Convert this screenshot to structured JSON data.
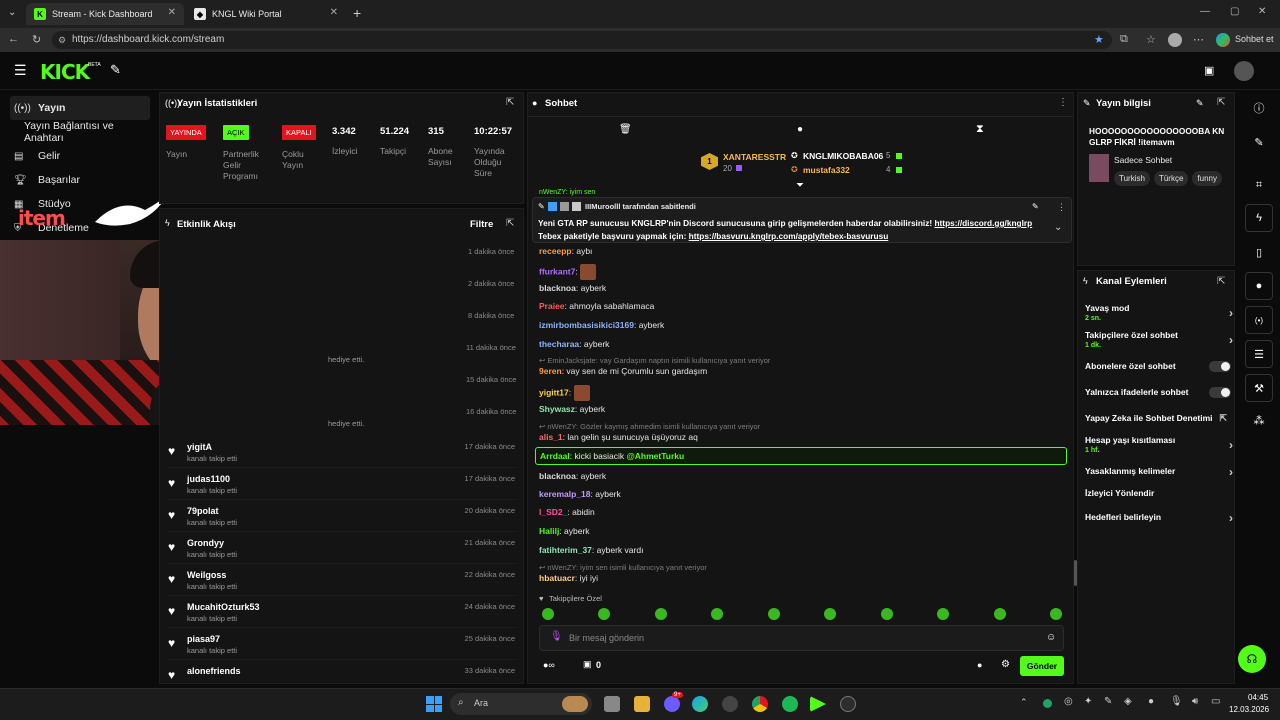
{
  "browser": {
    "tabs": [
      {
        "title": "Stream - Kick Dashboard",
        "active": true
      },
      {
        "title": "KNGL Wiki Portal",
        "active": false
      }
    ],
    "url": "https://dashboard.kick.com/stream",
    "profile_label": "Sohbet et"
  },
  "header": {
    "logo": "KICK",
    "beta": "BETA"
  },
  "sidebar": {
    "items": [
      {
        "label": "Yayın",
        "icon": "broadcast-icon"
      },
      {
        "label": "Yayın Bağlantısı ve Anahtarı",
        "icon": "key-icon"
      },
      {
        "label": "Gelir",
        "icon": "money-icon"
      },
      {
        "label": "Başarılar",
        "icon": "trophy-icon"
      },
      {
        "label": "Stüdyo",
        "icon": "studio-icon"
      },
      {
        "label": "Denetleme",
        "icon": "shield-icon"
      }
    ]
  },
  "stats_panel": {
    "title": "Yayın İstatistikleri",
    "badges": [
      {
        "badge": "YAYINDA",
        "label": "Yayın",
        "color": "#e4141e"
      },
      {
        "badge": "AÇIK",
        "label": "Partnerlik Gelir Programı",
        "color": "#53fc18"
      },
      {
        "badge": "KAPALI",
        "label": "Çoklu Yayın",
        "color": "#e4141e"
      }
    ],
    "numbers": [
      {
        "value": "3.342",
        "label": "İzleyici"
      },
      {
        "value": "51.224",
        "label": "Takipçi"
      },
      {
        "value": "315",
        "label": "Abone Sayısı"
      },
      {
        "value": "10:22:57",
        "label": "Yayında Olduğu Süre"
      }
    ]
  },
  "activity": {
    "title": "Etkinlik Akışı",
    "filter": "Filtre",
    "hidden_times": [
      "1 dakika önce",
      "2 dakika önce",
      "8 dakika önce",
      "11 dakika önce",
      "15 dakika önce",
      "16 dakika önce"
    ],
    "partial_texts": [
      "hediye etti.",
      "kanalı takip etti.",
      "hediye etti."
    ],
    "rows": [
      {
        "name": "yigitA",
        "sub": "kanalı takip etti",
        "time": "17 dakika önce"
      },
      {
        "name": "judas1100",
        "sub": "kanalı takip etti",
        "time": "17 dakika önce"
      },
      {
        "name": "79polat",
        "sub": "kanalı takip etti",
        "time": "20 dakika önce"
      },
      {
        "name": "Grondyy",
        "sub": "kanalı takip etti",
        "time": "21 dakika önce"
      },
      {
        "name": "Weilgoss",
        "sub": "kanalı takip etti",
        "time": "22 dakika önce"
      },
      {
        "name": "MucahitOzturk53",
        "sub": "kanalı takip etti",
        "time": "24 dakika önce"
      },
      {
        "name": "piasa97",
        "sub": "kanalı takip etti",
        "time": "25 dakika önce"
      },
      {
        "name": "alonefriends",
        "sub": "",
        "time": "33 dakika önce"
      }
    ]
  },
  "chat": {
    "title": "Sohbet",
    "leaderboard": {
      "first": {
        "rank": "1",
        "name": "XANTARESSTR",
        "points": "20"
      },
      "second": {
        "name": "KNGLMIKOBABA06",
        "points": "5"
      },
      "third": {
        "name": "mustafa332",
        "points": "4"
      }
    },
    "pinned": {
      "by": "IIIMuroolll tarafından sabitlendi",
      "text1": "Yeni GTA RP sunucusu KNGLRP'nin Discord sunucusuna girip gelişmelerden haberdar olabilirsiniz!",
      "link1": "https://discord.gg/knglrp",
      "text2": "Tebex paketiyle başvuru yapmak için:",
      "link2": "https://basvuru.knglrp.com/apply/tebex-basvurusu",
      "partial_msg": "nWenZY: iyim sen"
    },
    "messages": [
      {
        "user": "receepp",
        "text": "aybı",
        "color": "#ff9a3c"
      },
      {
        "user": "ffurkant7",
        "text": "",
        "color": "#b06cff"
      },
      {
        "user": "blacknoa",
        "text": "ayberk",
        "color": "#d9d9d9"
      },
      {
        "user": "Praiee",
        "text": "ahmoyla sabahlamaca",
        "color": "#ff5a5a"
      },
      {
        "user": "izmirbombasisikici3169",
        "text": "ayberk",
        "color": "#8ab4ff"
      },
      {
        "user": "thecharaa",
        "text": "ayberk",
        "color": "#8ab4ff"
      },
      {
        "reply": "EminJacksjate: vay Gardaşım naptın isimili kullanıcıya yanıt veriyor"
      },
      {
        "user": "9eren",
        "text": "vay sen de mi Çorumlu sun gardaşım",
        "color": "#ff9a3c"
      },
      {
        "user": "yigitt17",
        "text": "",
        "color": "#ffd23c"
      },
      {
        "user": "Shywasz",
        "text": "ayberk",
        "color": "#8ee4b0"
      },
      {
        "reply": "nWenZY: Gözler kaymış ahmedim isimli kullanıcıya yanıt veriyor"
      },
      {
        "user": "alis_1",
        "text": "lan gelin şu sunucuya üşüyoruz aq",
        "color": "#ff6a6a"
      },
      {
        "user": "Arrdaal",
        "text": "kicki basiacik",
        "mention": "@AhmetTurku",
        "color": "#53fc18",
        "highlight": true
      },
      {
        "user": "blacknoa",
        "text": "ayberk",
        "color": "#d9d9d9"
      },
      {
        "user": "keremalp_18",
        "text": "ayberk",
        "color": "#c39bff"
      },
      {
        "user": "l_SD2_",
        "text": "abidin",
        "color": "#ff4fa0"
      },
      {
        "user": "Halilj",
        "text": "ayberk",
        "color": "#53fc18"
      },
      {
        "user": "fatihterim_37",
        "text": "ayberk vardı",
        "color": "#8ee4b0"
      },
      {
        "reply": "nWenZY: iyim sen isimli kullanıcıya yanıt veriyor"
      },
      {
        "user": "hbatuacr",
        "text": "iyi iyi",
        "color": "#ffd27a"
      }
    ],
    "followers_only": "Takipçilere Özel",
    "input_placeholder": "Bir mesaj gönderin",
    "send": "Gönder",
    "footer_count": "0"
  },
  "stream_info": {
    "title": "Yayın bilgisi",
    "stream_title": "HOOOOOOOOOOOOOOOOBA KNGLRP FİKRİ !itemavm",
    "category": "Sadece Sohbet",
    "tags": [
      "Turkish",
      "Türkçe",
      "funny"
    ]
  },
  "channel_actions": {
    "title": "Kanal Eylemleri",
    "rows": [
      {
        "label": "Yavaş mod",
        "sub": "2 sn.",
        "control": "chevron"
      },
      {
        "label": "Takipçilere özel sohbet",
        "sub": "1 dk.",
        "control": "chevron"
      },
      {
        "label": "Abonelere özel sohbet",
        "sub": "",
        "control": "toggle"
      },
      {
        "label": "Yalnızca ifadelerle sohbet",
        "sub": "",
        "control": "toggle"
      },
      {
        "label": "Yapay Zeka ile Sohbet Denetimi",
        "sub": "",
        "control": "external"
      },
      {
        "label": "Hesap yaşı kısıtlaması",
        "sub": "1 hf.",
        "control": "chevron"
      },
      {
        "label": "Yasaklanmış kelimeler",
        "sub": "",
        "control": "chevron"
      },
      {
        "label": "İzleyici Yönlendir",
        "sub": "",
        "control": "none"
      },
      {
        "label": "Hedefleri belirleyin",
        "sub": "",
        "control": "chevron"
      }
    ]
  },
  "taskbar": {
    "search": "Ara",
    "time": "04:45",
    "date": "12.03.2026",
    "badge": "9+"
  },
  "overlay": {
    "logo_text": "item"
  },
  "colors": {
    "kick_green": "#53fc18",
    "live_red": "#e4141e",
    "panel_bg": "#141414"
  }
}
